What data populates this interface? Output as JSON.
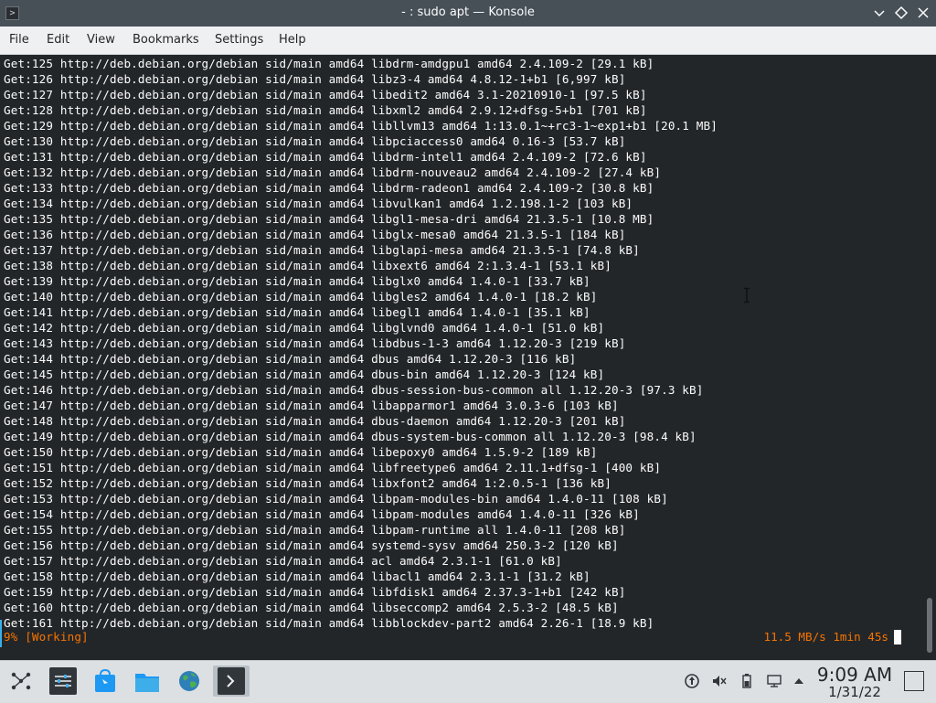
{
  "window": {
    "title": "- : sudo apt — Konsole",
    "controls": [
      "minimize",
      "maximize",
      "close"
    ]
  },
  "menu": [
    "File",
    "Edit",
    "View",
    "Bookmarks",
    "Settings",
    "Help"
  ],
  "terminal": {
    "lines": [
      "Get:125 http://deb.debian.org/debian sid/main amd64 libdrm-amdgpu1 amd64 2.4.109-2 [29.1 kB]",
      "Get:126 http://deb.debian.org/debian sid/main amd64 libz3-4 amd64 4.8.12-1+b1 [6,997 kB]",
      "Get:127 http://deb.debian.org/debian sid/main amd64 libedit2 amd64 3.1-20210910-1 [97.5 kB]",
      "Get:128 http://deb.debian.org/debian sid/main amd64 libxml2 amd64 2.9.12+dfsg-5+b1 [701 kB]",
      "Get:129 http://deb.debian.org/debian sid/main amd64 libllvm13 amd64 1:13.0.1~+rc3-1~exp1+b1 [20.1 MB]",
      "Get:130 http://deb.debian.org/debian sid/main amd64 libpciaccess0 amd64 0.16-3 [53.7 kB]",
      "Get:131 http://deb.debian.org/debian sid/main amd64 libdrm-intel1 amd64 2.4.109-2 [72.6 kB]",
      "Get:132 http://deb.debian.org/debian sid/main amd64 libdrm-nouveau2 amd64 2.4.109-2 [27.4 kB]",
      "Get:133 http://deb.debian.org/debian sid/main amd64 libdrm-radeon1 amd64 2.4.109-2 [30.8 kB]",
      "Get:134 http://deb.debian.org/debian sid/main amd64 libvulkan1 amd64 1.2.198.1-2 [103 kB]",
      "Get:135 http://deb.debian.org/debian sid/main amd64 libgl1-mesa-dri amd64 21.3.5-1 [10.8 MB]",
      "Get:136 http://deb.debian.org/debian sid/main amd64 libglx-mesa0 amd64 21.3.5-1 [184 kB]",
      "Get:137 http://deb.debian.org/debian sid/main amd64 libglapi-mesa amd64 21.3.5-1 [74.8 kB]",
      "Get:138 http://deb.debian.org/debian sid/main amd64 libxext6 amd64 2:1.3.4-1 [53.1 kB]",
      "Get:139 http://deb.debian.org/debian sid/main amd64 libglx0 amd64 1.4.0-1 [33.7 kB]",
      "Get:140 http://deb.debian.org/debian sid/main amd64 libgles2 amd64 1.4.0-1 [18.2 kB]",
      "Get:141 http://deb.debian.org/debian sid/main amd64 libegl1 amd64 1.4.0-1 [35.1 kB]",
      "Get:142 http://deb.debian.org/debian sid/main amd64 libglvnd0 amd64 1.4.0-1 [51.0 kB]",
      "Get:143 http://deb.debian.org/debian sid/main amd64 libdbus-1-3 amd64 1.12.20-3 [219 kB]",
      "Get:144 http://deb.debian.org/debian sid/main amd64 dbus amd64 1.12.20-3 [116 kB]",
      "Get:145 http://deb.debian.org/debian sid/main amd64 dbus-bin amd64 1.12.20-3 [124 kB]",
      "Get:146 http://deb.debian.org/debian sid/main amd64 dbus-session-bus-common all 1.12.20-3 [97.3 kB]",
      "Get:147 http://deb.debian.org/debian sid/main amd64 libapparmor1 amd64 3.0.3-6 [103 kB]",
      "Get:148 http://deb.debian.org/debian sid/main amd64 dbus-daemon amd64 1.12.20-3 [201 kB]",
      "Get:149 http://deb.debian.org/debian sid/main amd64 dbus-system-bus-common all 1.12.20-3 [98.4 kB]",
      "Get:150 http://deb.debian.org/debian sid/main amd64 libepoxy0 amd64 1.5.9-2 [189 kB]",
      "Get:151 http://deb.debian.org/debian sid/main amd64 libfreetype6 amd64 2.11.1+dfsg-1 [400 kB]",
      "Get:152 http://deb.debian.org/debian sid/main amd64 libxfont2 amd64 1:2.0.5-1 [136 kB]",
      "Get:153 http://deb.debian.org/debian sid/main amd64 libpam-modules-bin amd64 1.4.0-11 [108 kB]",
      "Get:154 http://deb.debian.org/debian sid/main amd64 libpam-modules amd64 1.4.0-11 [326 kB]",
      "Get:155 http://deb.debian.org/debian sid/main amd64 libpam-runtime all 1.4.0-11 [208 kB]",
      "Get:156 http://deb.debian.org/debian sid/main amd64 systemd-sysv amd64 250.3-2 [120 kB]",
      "Get:157 http://deb.debian.org/debian sid/main amd64 acl amd64 2.3.1-1 [61.0 kB]",
      "Get:158 http://deb.debian.org/debian sid/main amd64 libacl1 amd64 2.3.1-1 [31.2 kB]",
      "Get:159 http://deb.debian.org/debian sid/main amd64 libfdisk1 amd64 2.37.3-1+b1 [242 kB]",
      "Get:160 http://deb.debian.org/debian sid/main amd64 libseccomp2 amd64 2.5.3-2 [48.5 kB]",
      "Get:161 http://deb.debian.org/debian sid/main amd64 libblockdev-part2 amd64 2.26-1 [18.9 kB]"
    ],
    "status_left": "9% [Working]",
    "status_right": "11.5 MB/s 1min 45s"
  },
  "taskbar": {
    "launcher_icons": [
      "application-launcher-icon",
      "system-settings-icon",
      "discover-icon",
      "dolphin-file-manager-icon",
      "web-browser-icon",
      "konsole-icon"
    ],
    "tray_icons": [
      "updates-icon",
      "volume-muted-icon",
      "battery-icon",
      "network-icon",
      "tray-expand-icon"
    ],
    "clock_time": "9:09 AM",
    "clock_date": "1/31/22"
  },
  "colors": {
    "terminal_bg": "#232629",
    "terminal_fg": "#fcfcfc",
    "status_orange": "#f67400",
    "accent": "#3daee9"
  }
}
